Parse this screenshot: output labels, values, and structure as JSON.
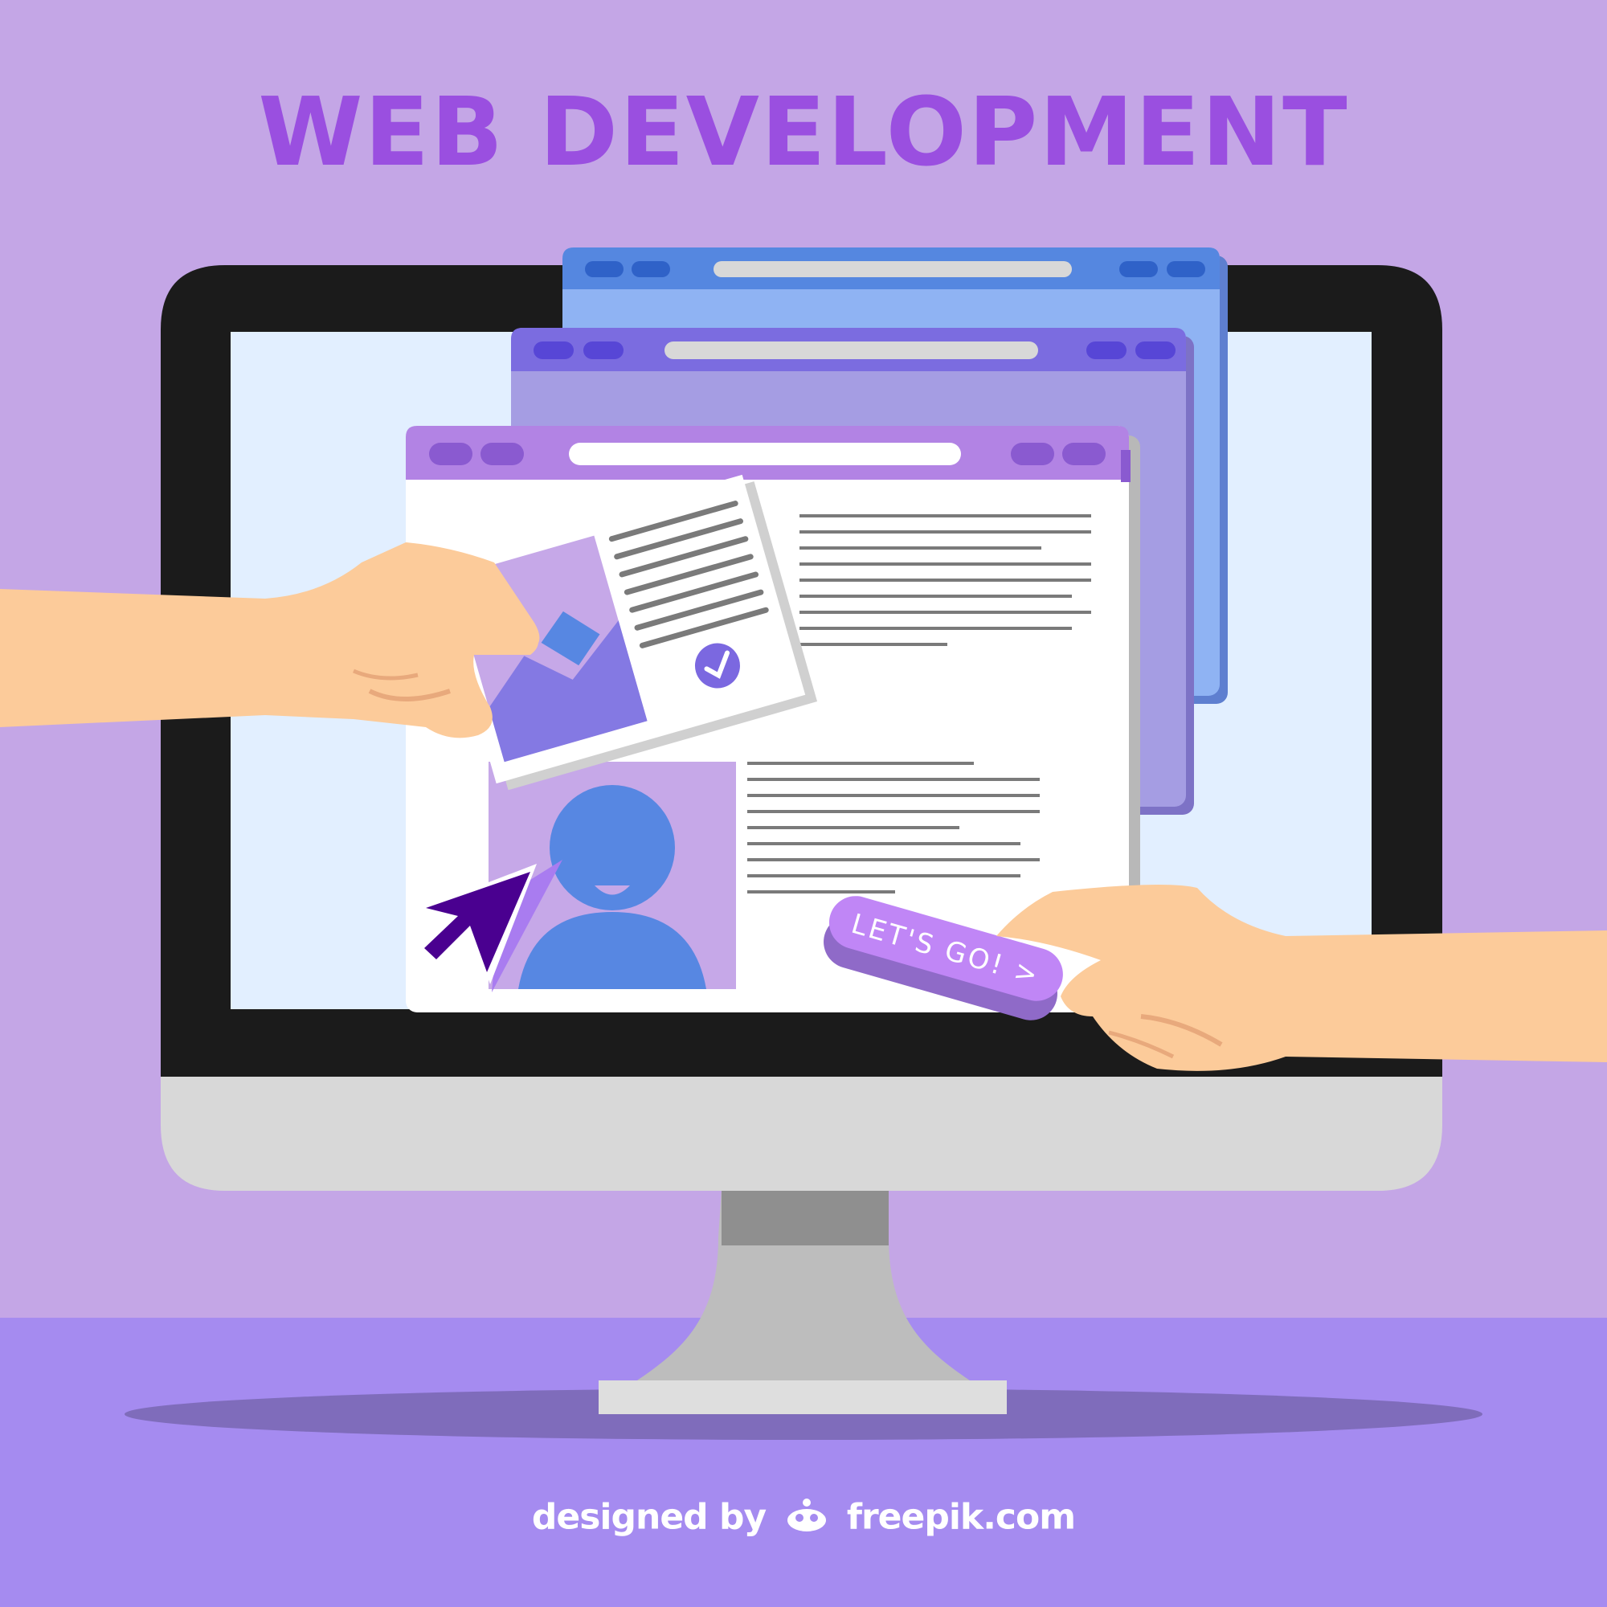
{
  "title": "WEB DEVELOPMENT",
  "button": {
    "label": "LET'S GO! >"
  },
  "credit": {
    "prefix": "designed by",
    "brand": "freepik.com"
  },
  "colors": {
    "background": "#c4a6e6",
    "floor": "#a58bf0",
    "title": "#9a4fe0",
    "monitor_bezel": "#1b1b1b",
    "monitor_chin": "#d8d8d8",
    "screen": "#e2efff",
    "window_blue": "#8fb3f3",
    "window_violet": "#a59de3",
    "window_front_bar": "#b283e4",
    "cursor": "#4a0090",
    "avatar": "#5787e2",
    "button": "#c086f6",
    "skin": "#fccb9a"
  },
  "icons": [
    "cursor-arrow-icon",
    "checkmark-icon",
    "image-placeholder-icon",
    "user-avatar-icon",
    "freepik-logo-icon"
  ]
}
